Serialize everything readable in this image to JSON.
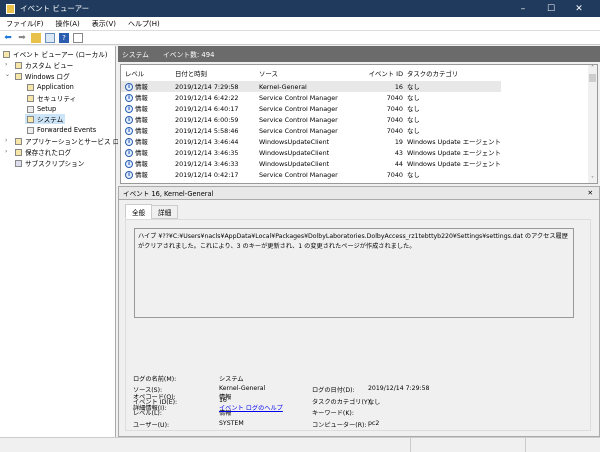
{
  "window": {
    "title": "イベント ビューアー",
    "minimize": "–",
    "maximize": "☐",
    "close": "✕"
  },
  "menu": [
    "ファイル(F)",
    "操作(A)",
    "表示(V)",
    "ヘルプ(H)"
  ],
  "tree": {
    "root": "イベント ビューアー (ローカル)",
    "custom": "カスタム ビュー",
    "winlogs": "Windows ログ",
    "application": "Application",
    "security": "セキュリティ",
    "setup": "Setup",
    "system": "システム",
    "forwarded": "Forwarded Events",
    "appsvc": "アプリケーションとサービス ログ",
    "saved": "保存されたログ",
    "subs": "サブスクリプション"
  },
  "list": {
    "name": "システム",
    "count": "イベント数: 494",
    "columns": [
      "レベル",
      "日付と時刻",
      "ソース",
      "イベント ID",
      "タスクのカテゴリ"
    ],
    "rows": [
      [
        "情報",
        "2019/12/14 7:29:58",
        "Kernel-General",
        "16",
        "なし"
      ],
      [
        "情報",
        "2019/12/14 6:42:22",
        "Service Control Manager",
        "7040",
        "なし"
      ],
      [
        "情報",
        "2019/12/14 6:40:17",
        "Service Control Manager",
        "7040",
        "なし"
      ],
      [
        "情報",
        "2019/12/14 6:00:59",
        "Service Control Manager",
        "7040",
        "なし"
      ],
      [
        "情報",
        "2019/12/14 5:58:46",
        "Service Control Manager",
        "7040",
        "なし"
      ],
      [
        "情報",
        "2019/12/14 3:46:44",
        "WindowsUpdateClient",
        "19",
        "Windows Update エージェント"
      ],
      [
        "情報",
        "2019/12/14 3:46:35",
        "WindowsUpdateClient",
        "43",
        "Windows Update エージェント"
      ],
      [
        "情報",
        "2019/12/14 3:46:33",
        "WindowsUpdateClient",
        "44",
        "Windows Update エージェント"
      ],
      [
        "情報",
        "2019/12/14 0:42:17",
        "Service Control Manager",
        "7040",
        "なし"
      ]
    ]
  },
  "detail": {
    "title": "イベント 16, Kernel-General",
    "close": "✕",
    "tabs": [
      "全般",
      "詳細"
    ],
    "message": "ハイブ ¥??¥C:¥Users¥nacls¥AppData¥Local¥Packages¥DolbyLaboratories.DolbyAccess_rz1tebttyb220¥Settings¥settings.dat のアクセス履歴がクリアされました。これにより、3 のキーが更新され、1 の変更されたページが作成されました。",
    "fields": {
      "logname_label": "ログの名前(M):",
      "logname": "システム",
      "source_label": "ソース(S):",
      "source": "Kernel-General",
      "date_label": "ログの日付(D):",
      "date": "2019/12/14 7:29:58",
      "eventid_label": "イベント ID(E):",
      "eventid": "16",
      "task_label": "タスクのカテゴリ(Y):",
      "task": "なし",
      "level_label": "レベル(L):",
      "level": "情報",
      "keyword_label": "キーワード(K):",
      "user_label": "ユーザー(U):",
      "user": "SYSTEM",
      "computer_label": "コンピューター(R):",
      "computer": "pc2",
      "opcode_label": "オペコード(O):",
      "opcode": "情報",
      "more_label": "詳細情報(I):",
      "more_link": "イベント ログのヘルプ"
    }
  }
}
